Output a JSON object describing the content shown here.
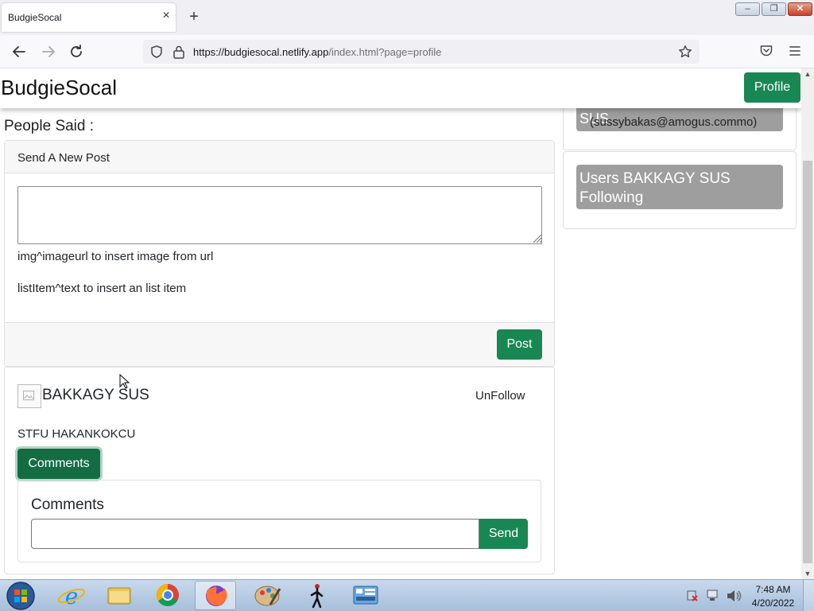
{
  "browser": {
    "tab_title": "BudgieSocal",
    "tab_close": "×",
    "new_tab": "+",
    "url_host": "https://budgiesocal.netlify.app",
    "url_path": "/index.html?page=profile",
    "window_min": "–",
    "window_max": "❐",
    "window_close": "✕"
  },
  "app": {
    "brand": "BudgieSocal",
    "profile_button": "Profile",
    "people_said": "People Said :"
  },
  "new_post": {
    "header": "Send A New Post",
    "textarea_value": "",
    "hint_image": "img^imageurl to insert image from url",
    "hint_list": "listItem^text to insert an list item",
    "post_button": "Post"
  },
  "post": {
    "author": "BAKKAGY SUS",
    "unfollow": "UnFollow",
    "text": "STFU HAKANKOKCU",
    "comments_button": "Comments",
    "comments_title": "Comments",
    "comment_input_value": "",
    "send_button": "Send"
  },
  "sidebar": {
    "user_name": "SUS",
    "user_email": "(sussybakas@amogus.commo)",
    "following_label": "Users BAKKAGY SUS Following"
  },
  "taskbar": {
    "time": "7:48 AM",
    "date": "4/20/2022"
  },
  "colors": {
    "accent_green": "#198754",
    "sidebar_gray": "#9e9e9e"
  }
}
